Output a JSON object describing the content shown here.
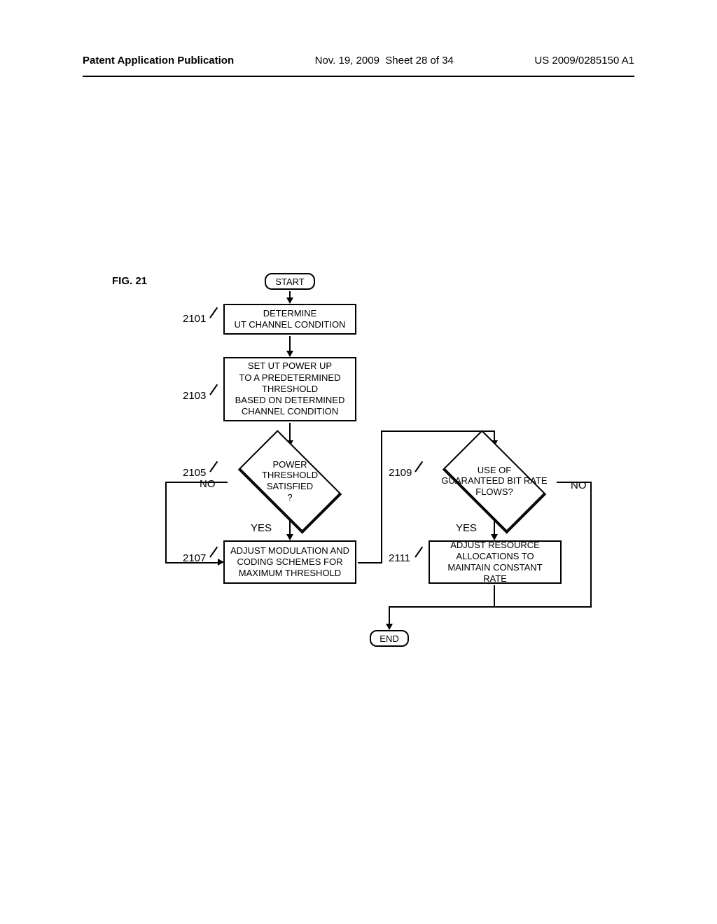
{
  "header": {
    "pub": "Patent Application Publication",
    "date": "Nov. 19, 2009",
    "sheet": "Sheet 28 of 34",
    "docnum": "US 2009/0285150 A1"
  },
  "figure": {
    "label": "FIG. 21"
  },
  "flow": {
    "start": "START",
    "end": "END",
    "s2101": "DETERMINE\nUT CHANNEL CONDITION",
    "s2103": "SET UT POWER UP\nTO A PREDETERMINED\nTHRESHOLD\nBASED ON DETERMINED\nCHANNEL CONDITION",
    "d2105": "POWER\nTHRESHOLD\nSATISFIED\n?",
    "s2107": "ADJUST MODULATION AND\nCODING SCHEMES FOR\nMAXIMUM THRESHOLD",
    "d2109": "USE OF\nGUARANTEED BIT RATE\nFLOWS?",
    "s2111": "ADJUST RESOURCE\nALLOCATIONS TO\nMAINTAIN CONSTANT RATE",
    "yes": "YES",
    "no": "NO"
  },
  "refs": {
    "r2101": "2101",
    "r2103": "2103",
    "r2105": "2105",
    "r2107": "2107",
    "r2109": "2109",
    "r2111": "2111"
  }
}
